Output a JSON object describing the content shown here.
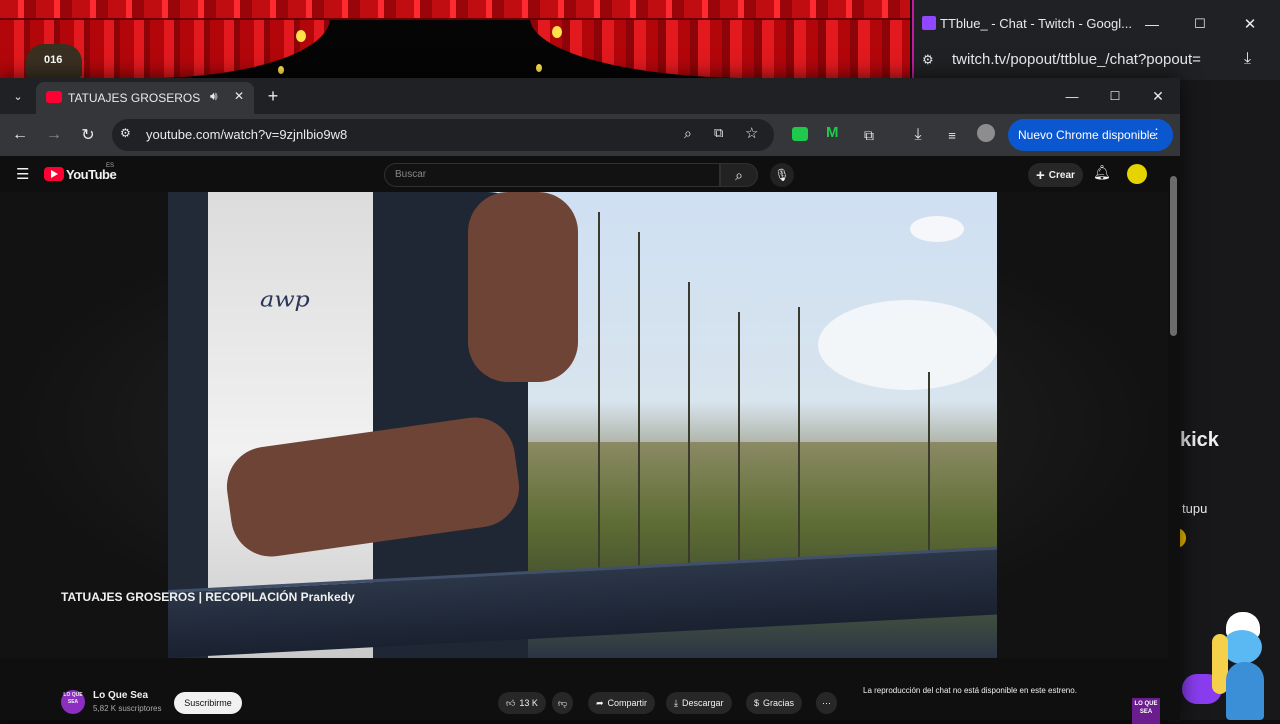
{
  "overlay": {
    "counter": "016"
  },
  "twitch_window": {
    "title": "TTblue_ - Chat - Twitch - Googl...",
    "url": "twitch.tv/popout/ttblue_/chat?popout=",
    "chat_snippet_1": "kick",
    "chat_snippet_2": "tupu"
  },
  "chrome": {
    "tab_title": "TATUAJES GROSEROS | RECOPILACIÓN",
    "url": "youtube.com/watch?v=9zjnlbio9w8",
    "update_button": "Nuevo Chrome disponible"
  },
  "youtube": {
    "logo": "YouTube",
    "logo_region": "ES",
    "search_placeholder": "Buscar",
    "create_label": "Crear",
    "video_title": "TATUAJES GROSEROS | RECOPILACIÓN Prankedy",
    "channel_avatar_text": "LO QUE SEA",
    "channel_name": "Lo Que Sea",
    "subscribers": "5,82 K suscriptores",
    "subscribe_button": "Suscribirme",
    "likes": "13 K",
    "share": "Compartir",
    "download": "Descargar",
    "thanks": "Gracias",
    "chat_disabled": "La reproducción del chat no está disponible en este estreno.",
    "watermark_text": "LO QUE SEA"
  },
  "colors": {
    "chrome_update_button": "#0b57d0",
    "channel_avatar": "#8b2fc0",
    "twitch_border": "#c21b9b"
  }
}
